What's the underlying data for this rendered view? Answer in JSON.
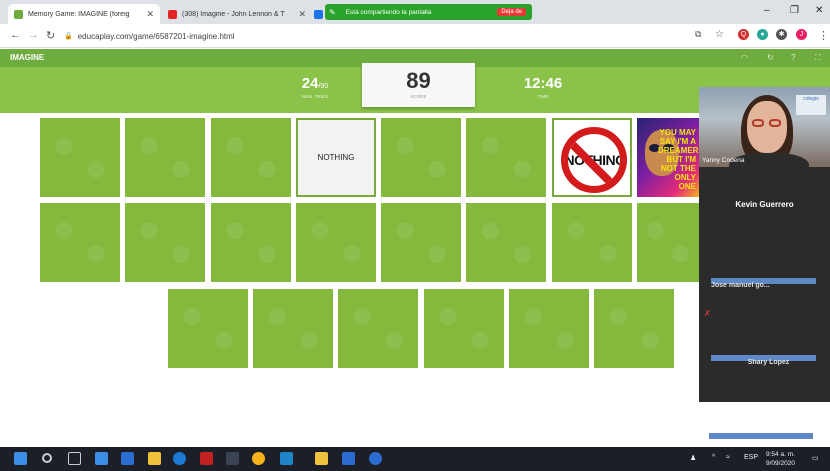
{
  "browser": {
    "tabs": [
      {
        "title": "Memory Game: IMAGINE (foreig",
        "active": true,
        "favicon_color": "#6fac3f"
      },
      {
        "title": "(308) Imagine - John Lennon & T",
        "active": false,
        "favicon_color": "#e52525"
      },
      {
        "title": "",
        "active": false,
        "favicon_color": "#1a73e8"
      }
    ],
    "share_banner": {
      "message": "Está compartiendo la pantalla",
      "stop_label": "Deja de"
    },
    "address": "educaplay.com/game/6587201-imagine.html",
    "window_controls": [
      "–",
      "❐",
      "✕"
    ]
  },
  "game": {
    "title": "IMAGINE",
    "stats": {
      "tries": {
        "value": "24",
        "suffix": "/90",
        "label": "NUM. TRIES"
      },
      "score": {
        "value": "89",
        "label": "SCORE"
      },
      "time": {
        "value": "12:46",
        "label": "TIME"
      }
    },
    "revealed": {
      "text_card": "NOTHING",
      "image_card_word": "NOTHING",
      "poster_text": "YOU MAY SAY I'M A DREAMER BUT I'M NOT THE ONLY ONE"
    },
    "toolbar_icons": [
      "sound-icon",
      "restart-icon",
      "help-icon",
      "fullscreen-icon"
    ]
  },
  "video_call": {
    "speaker": "Yanny Codena",
    "participants": [
      "Kevin Guerrero",
      "Jose manuel go...",
      "Shary Lopez"
    ],
    "sign_text": "colegio"
  },
  "taskbar": {
    "language": "ESP",
    "time": "9:54 a. m.",
    "date": "9/09/2020"
  }
}
